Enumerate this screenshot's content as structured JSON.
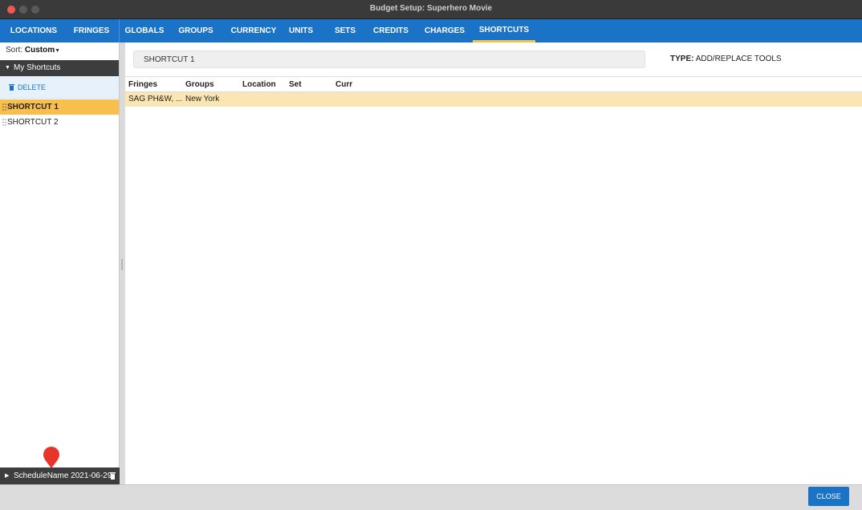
{
  "window": {
    "title": "Budget Setup: Superhero Movie"
  },
  "tabs": [
    {
      "label": "LOCATIONS"
    },
    {
      "label": "FRINGES"
    },
    {
      "label": "GLOBALS"
    },
    {
      "label": "GROUPS"
    },
    {
      "label": "CURRENCY"
    },
    {
      "label": "UNITS"
    },
    {
      "label": "SETS"
    },
    {
      "label": "CREDITS"
    },
    {
      "label": "CHARGES"
    },
    {
      "label": "SHORTCUTS",
      "active": true
    }
  ],
  "sidebar": {
    "sort_label": "Sort:",
    "sort_value": "Custom",
    "section_label": "My Shortcuts",
    "delete_label": "DELETE",
    "items": [
      {
        "label": "SHORTCUT 1",
        "selected": true
      },
      {
        "label": "SHORTCUT 2",
        "selected": false
      }
    ],
    "schedule_label": "ScheduleName 2021-06-29"
  },
  "main": {
    "name_value": "SHORTCUT 1",
    "type_label": "TYPE:",
    "type_value": "ADD/REPLACE TOOLS",
    "columns": [
      "Fringes",
      "Groups",
      "Location",
      "Set",
      "Curr"
    ],
    "rows": [
      [
        "SAG PH&W, ...",
        "New York",
        "",
        "",
        ""
      ]
    ]
  },
  "footer": {
    "close_label": "CLOSE"
  },
  "colors": {
    "tab_bar": "#1a73c6",
    "active_tab_underline": "#f8c24d",
    "selected_item": "#f8be4e",
    "row_highlight": "#fbe6b3",
    "dark_header": "#3d3d3d",
    "pin": "#e8352b"
  }
}
